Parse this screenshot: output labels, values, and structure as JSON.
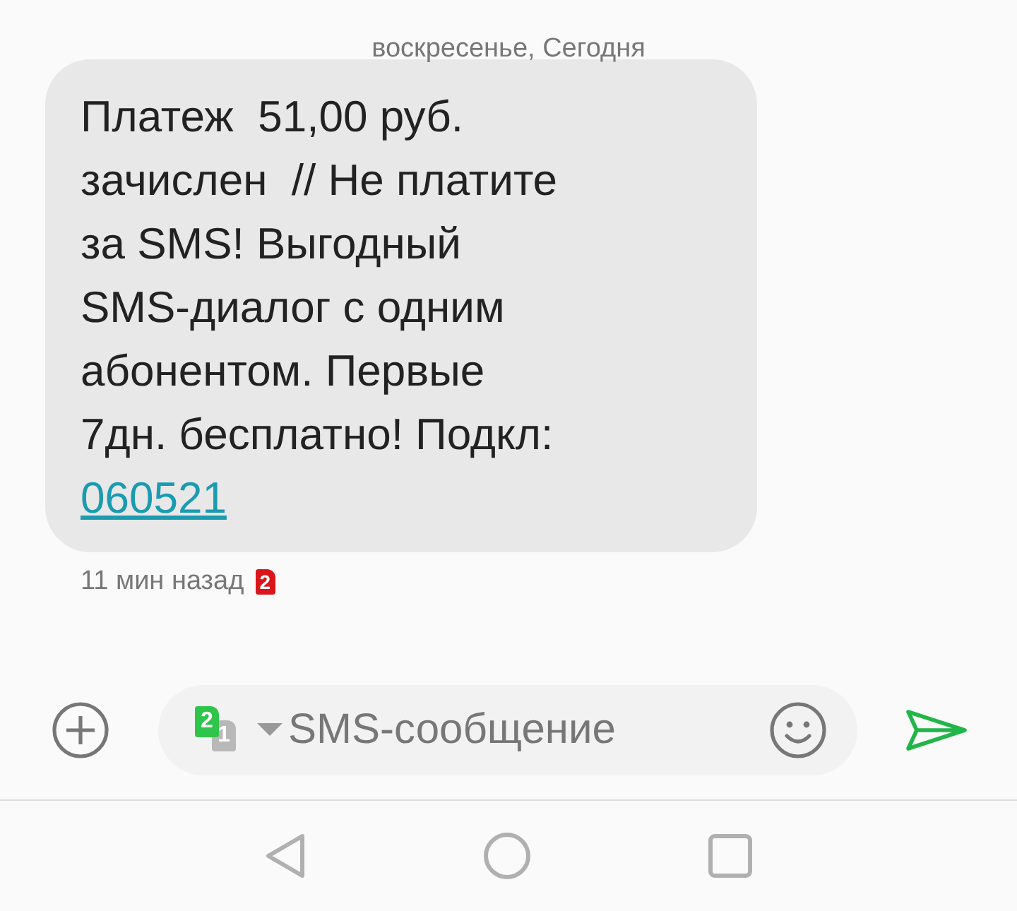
{
  "date_header": "воскресенье, Сегодня",
  "message": {
    "text": "Платеж  51,00 руб.\nзачислен  // Не платите\nза SMS! Выгодный\nSMS-диалог с одним\nабонентом. Первые\n7дн. бесплатно! Подкл:\n",
    "link": "060521",
    "time": "11 мин назад",
    "sim": "2"
  },
  "compose": {
    "sims": [
      {
        "label": "2",
        "selected": true
      },
      {
        "label": "1",
        "selected": false
      }
    ],
    "placeholder": "SMS-сообщение"
  }
}
